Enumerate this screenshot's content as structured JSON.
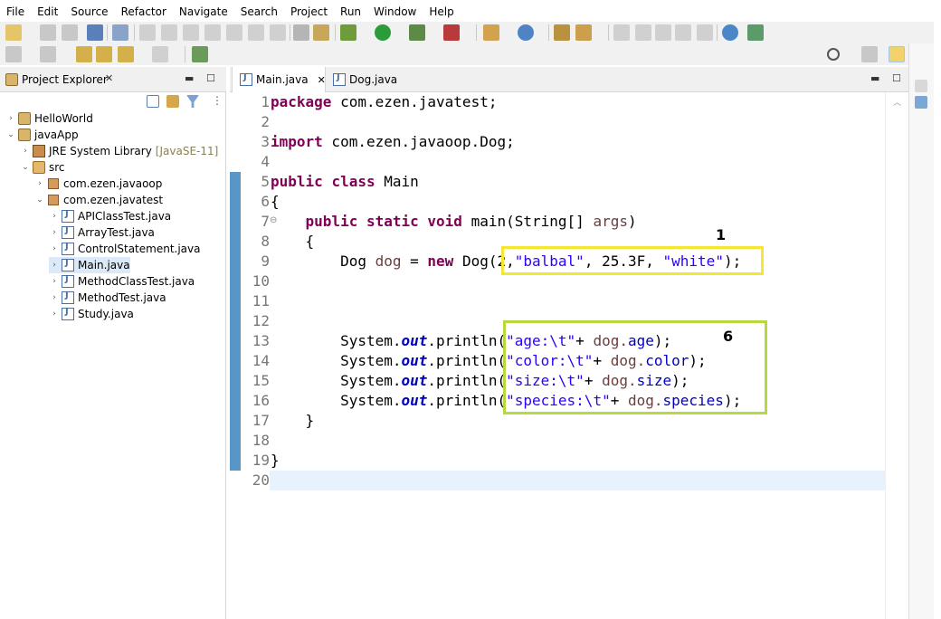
{
  "menu": [
    "File",
    "Edit",
    "Source",
    "Refactor",
    "Navigate",
    "Search",
    "Project",
    "Run",
    "Window",
    "Help"
  ],
  "explorer": {
    "title": "Project Explorer",
    "tree": [
      {
        "label": "HelloWorld",
        "toggle": "›",
        "icon": "project"
      },
      {
        "label": "javaApp",
        "toggle": "⌄",
        "icon": "project"
      },
      {
        "label": "JRE System Library",
        "decoration": "[JavaSE-11]",
        "toggle": "›",
        "icon": "library"
      },
      {
        "label": "src",
        "toggle": "⌄",
        "icon": "source-folder"
      },
      {
        "label": "com.ezen.javaoop",
        "toggle": "›",
        "icon": "package"
      },
      {
        "label": "com.ezen.javatest",
        "toggle": "⌄",
        "icon": "package"
      },
      {
        "label": "APIClassTest.java",
        "toggle": "›",
        "icon": "java-file"
      },
      {
        "label": "ArrayTest.java",
        "toggle": "›",
        "icon": "java-file"
      },
      {
        "label": "ControlStatement.java",
        "toggle": "›",
        "icon": "java-file"
      },
      {
        "label": "Main.java",
        "toggle": "›",
        "icon": "java-file",
        "selected": true
      },
      {
        "label": "MethodClassTest.java",
        "toggle": "›",
        "icon": "java-file"
      },
      {
        "label": "MethodTest.java",
        "toggle": "›",
        "icon": "java-file"
      },
      {
        "label": "Study.java",
        "toggle": "›",
        "icon": "java-file"
      }
    ]
  },
  "editor": {
    "tabs": [
      {
        "label": "Main.java",
        "active": true
      },
      {
        "label": "Dog.java",
        "active": false
      }
    ],
    "line_numbers": [
      "1",
      "2",
      "3",
      "4",
      "5",
      "6",
      "7",
      "8",
      "9",
      "10",
      "11",
      "12",
      "13",
      "14",
      "15",
      "16",
      "17",
      "18",
      "19",
      "20"
    ],
    "line7_marker": "⊖",
    "code": {
      "l1_kw": "package",
      "l1_rest": " com.ezen.javatest;",
      "l3_kw": "import",
      "l3_rest": " com.ezen.javaoop.Dog;",
      "l5_kw1": "public",
      "l5_kw2": "class",
      "l5_rest": " Main",
      "l6": "{",
      "l7_kw1": "public",
      "l7_kw2": "static",
      "l7_kw3": "void",
      "l7_rest": " main(String[] ",
      "l7_var": "args",
      "l7_end": ")",
      "l8": "{",
      "l9_a": "Dog ",
      "l9_var": "dog",
      "l9_b": " = ",
      "l9_kw": "new",
      "l9_c": " Dog(2,",
      "l9_s1": "\"balbal\"",
      "l9_d": ", 25.3F, ",
      "l9_s2": "\"white\"",
      "l9_e": ");",
      "sys": "System.",
      "out": "out",
      ".println": ".println(",
      "l13_str": "\"age:\\t\"",
      "l13_fld": "age",
      "l14_str": "\"color:\\t\"",
      "l14_fld": "color",
      "l15_str": "\"size:\\t\"",
      "l15_fld": "size",
      "l16_str": "\"species:\\t\"",
      "l16_fld": "species",
      "plus": "+ ",
      "dogdot": "dog.",
      "end": ");",
      "l17": "}",
      "l19": "}"
    }
  },
  "annotations": {
    "label1": "1",
    "label6": "6"
  },
  "colors": {
    "highlight_yellow": "#f5e633",
    "highlight_green": "#b5d93f"
  }
}
